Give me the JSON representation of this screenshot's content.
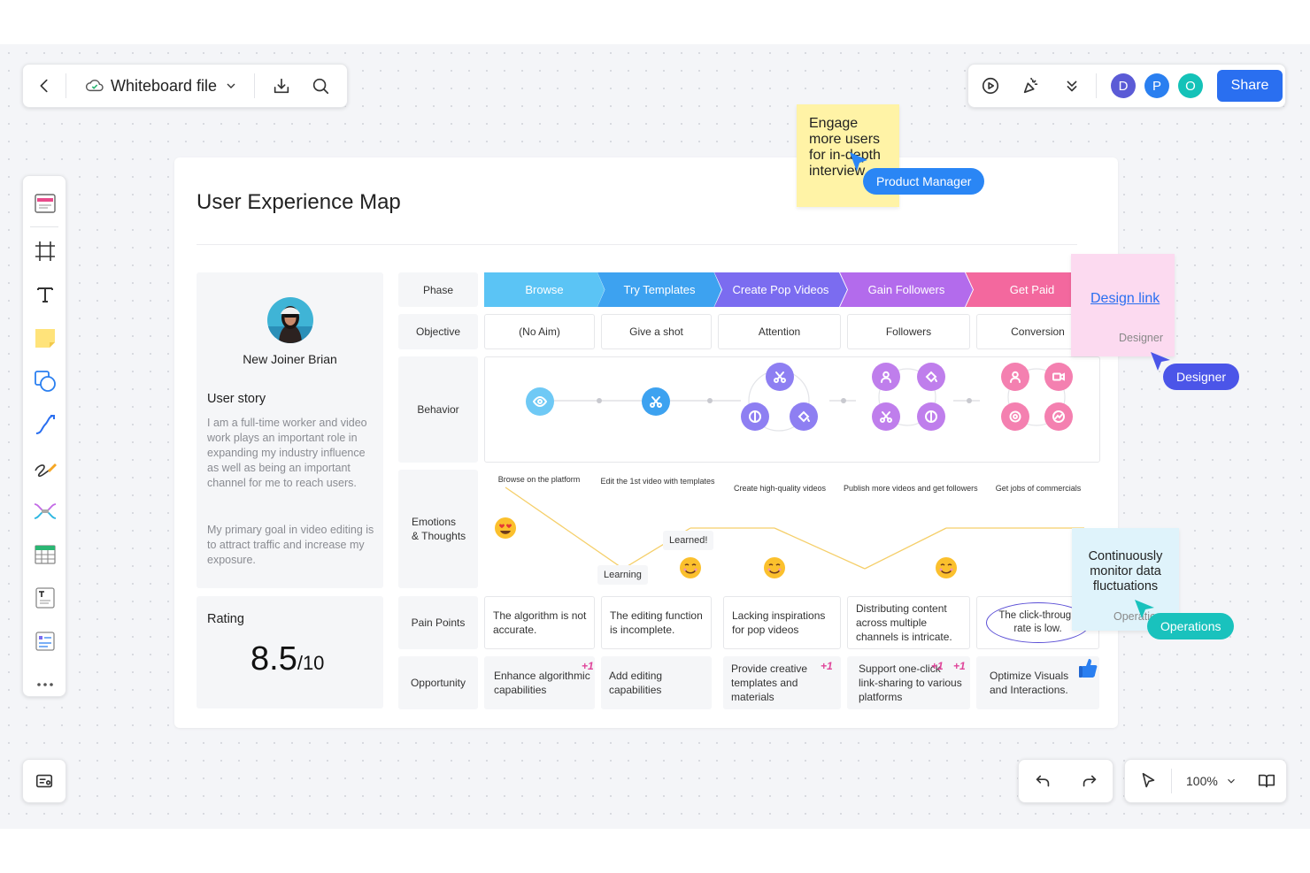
{
  "app": {
    "file_title": "Whiteboard file",
    "share_label": "Share",
    "avatars": [
      {
        "letter": "D",
        "color": "#5b5bd6"
      },
      {
        "letter": "P",
        "color": "#2a7ff0"
      },
      {
        "letter": "O",
        "color": "#14c2b8"
      }
    ],
    "zoom": "100%"
  },
  "map": {
    "title": "User Experience Map",
    "profile": {
      "name": "New Joiner Brian",
      "story_heading": "User story",
      "story_p1": "I am a full-time worker and video work plays an important role in expanding my industry influence as well as being an important channel for me to reach users.",
      "story_p2": "My primary goal in video editing is to attract traffic and increase my exposure."
    },
    "rating": {
      "label": "Rating",
      "value": "8.5",
      "suffix": "/10"
    },
    "row_labels": {
      "phase": "Phase",
      "objective": "Objective",
      "behavior": "Behavior",
      "emotions_1": "Emotions",
      "emotions_2": "& Thoughts",
      "pain": "Pain Points",
      "opportunity": "Opportunity"
    },
    "phases": [
      {
        "label": "Browse",
        "color": "#5bc4f5"
      },
      {
        "label": "Try Templates",
        "color": "#3da2f0"
      },
      {
        "label": "Create Pop Videos",
        "color": "#7b6cf0"
      },
      {
        "label": "Gain Followers",
        "color": "#b36bec"
      },
      {
        "label": "Get Paid",
        "color": "#f3689e"
      }
    ],
    "objectives": [
      "(No Aim)",
      "Give a shot",
      "Attention",
      "Followers",
      "Conversion"
    ],
    "behaviors": [
      "Browse on the platform",
      "Edit the 1st video with templates",
      "Create high-quality videos",
      "Publish more videos and get followers",
      "Get jobs of commercials"
    ],
    "emotion_notes": {
      "learning": "Learning",
      "learned": "Learned!"
    },
    "pain_points": [
      "The algorithm is not accurate.",
      "The editing function is incomplete.",
      "Lacking inspirations for pop videos",
      "Distributing content across multiple channels is intricate.",
      "The click-through rate is low."
    ],
    "opportunities": [
      "Enhance algorithmic capabilities",
      "Add editing capabilities",
      "Provide creative templates and materials",
      "Support one-click link-sharing to various platforms",
      "Optimize Visuals and Interactions."
    ],
    "plus_one": "+1"
  },
  "collab": {
    "pm_note": "Engage more users for in-depth interview",
    "pm_label": "Product Manager",
    "design_link": "Design link",
    "designer_sign": "Designer",
    "designer_label": "Designer",
    "ops_note": "Continuously monitor data fluctuations",
    "ops_sign": "Operations",
    "ops_label": "Operations"
  }
}
